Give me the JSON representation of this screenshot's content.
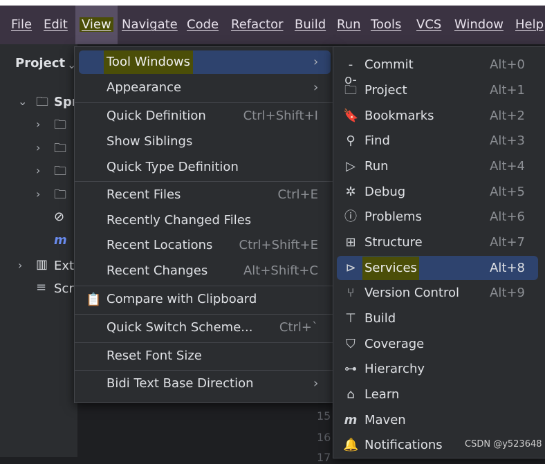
{
  "menubar": {
    "items": [
      "File",
      "Edit",
      "View",
      "Navigate",
      "Code",
      "Refactor",
      "Build",
      "Run",
      "Tools",
      "VCS",
      "Window",
      "Help"
    ]
  },
  "project": {
    "title": "Project",
    "root_label": "Spr",
    "ext_label": "Ext",
    "scr_label": "Scr"
  },
  "editor": {
    "line_numbers": [
      "15",
      "16",
      "17"
    ]
  },
  "view_menu": {
    "items": [
      {
        "label": "Tool Windows",
        "shortcut": "",
        "submenu": true
      },
      {
        "label": "Appearance",
        "shortcut": "",
        "submenu": true
      },
      {
        "label": "Quick Definition",
        "shortcut": "Ctrl+Shift+I"
      },
      {
        "label": "Show Siblings",
        "shortcut": ""
      },
      {
        "label": "Quick Type Definition",
        "shortcut": ""
      },
      {
        "label": "Recent Files",
        "shortcut": "Ctrl+E"
      },
      {
        "label": "Recently Changed Files",
        "shortcut": ""
      },
      {
        "label": "Recent Locations",
        "shortcut": "Ctrl+Shift+E"
      },
      {
        "label": "Recent Changes",
        "shortcut": "Alt+Shift+C"
      },
      {
        "label": "Compare with Clipboard",
        "shortcut": ""
      },
      {
        "label": "Quick Switch Scheme...",
        "shortcut": "Ctrl+`"
      },
      {
        "label": "Reset Font Size",
        "shortcut": ""
      },
      {
        "label": "Bidi Text Base Direction",
        "shortcut": "",
        "submenu": true
      }
    ]
  },
  "tool_menu": {
    "items": [
      {
        "label": "Commit",
        "shortcut": "Alt+0",
        "icon": "commit-icon"
      },
      {
        "label": "Project",
        "shortcut": "Alt+1",
        "icon": "folder-icon"
      },
      {
        "label": "Bookmarks",
        "shortcut": "Alt+2",
        "icon": "bookmark-icon"
      },
      {
        "label": "Find",
        "shortcut": "Alt+3",
        "icon": "search-icon"
      },
      {
        "label": "Run",
        "shortcut": "Alt+4",
        "icon": "play-icon"
      },
      {
        "label": "Debug",
        "shortcut": "Alt+5",
        "icon": "bug-icon"
      },
      {
        "label": "Problems",
        "shortcut": "Alt+6",
        "icon": "warning-icon"
      },
      {
        "label": "Structure",
        "shortcut": "Alt+7",
        "icon": "structure-icon"
      },
      {
        "label": "Services",
        "shortcut": "Alt+8",
        "icon": "services-icon"
      },
      {
        "label": "Version Control",
        "shortcut": "Alt+9",
        "icon": "branch-icon"
      },
      {
        "label": "Build",
        "shortcut": "",
        "icon": "hammer-icon"
      },
      {
        "label": "Coverage",
        "shortcut": "",
        "icon": "shield-icon"
      },
      {
        "label": "Hierarchy",
        "shortcut": "",
        "icon": "hierarchy-icon"
      },
      {
        "label": "Learn",
        "shortcut": "",
        "icon": "graduation-cap-icon"
      },
      {
        "label": "Maven",
        "shortcut": "",
        "icon": "maven-icon"
      },
      {
        "label": "Notifications",
        "shortcut": "",
        "icon": "bell-icon"
      }
    ]
  },
  "watermark": "CSDN @y523648",
  "colors": {
    "menubar_bg": "#3b3342",
    "menu_bg": "#2b2d30",
    "selection": "#2e436e",
    "highlight": "#4b4e08"
  }
}
